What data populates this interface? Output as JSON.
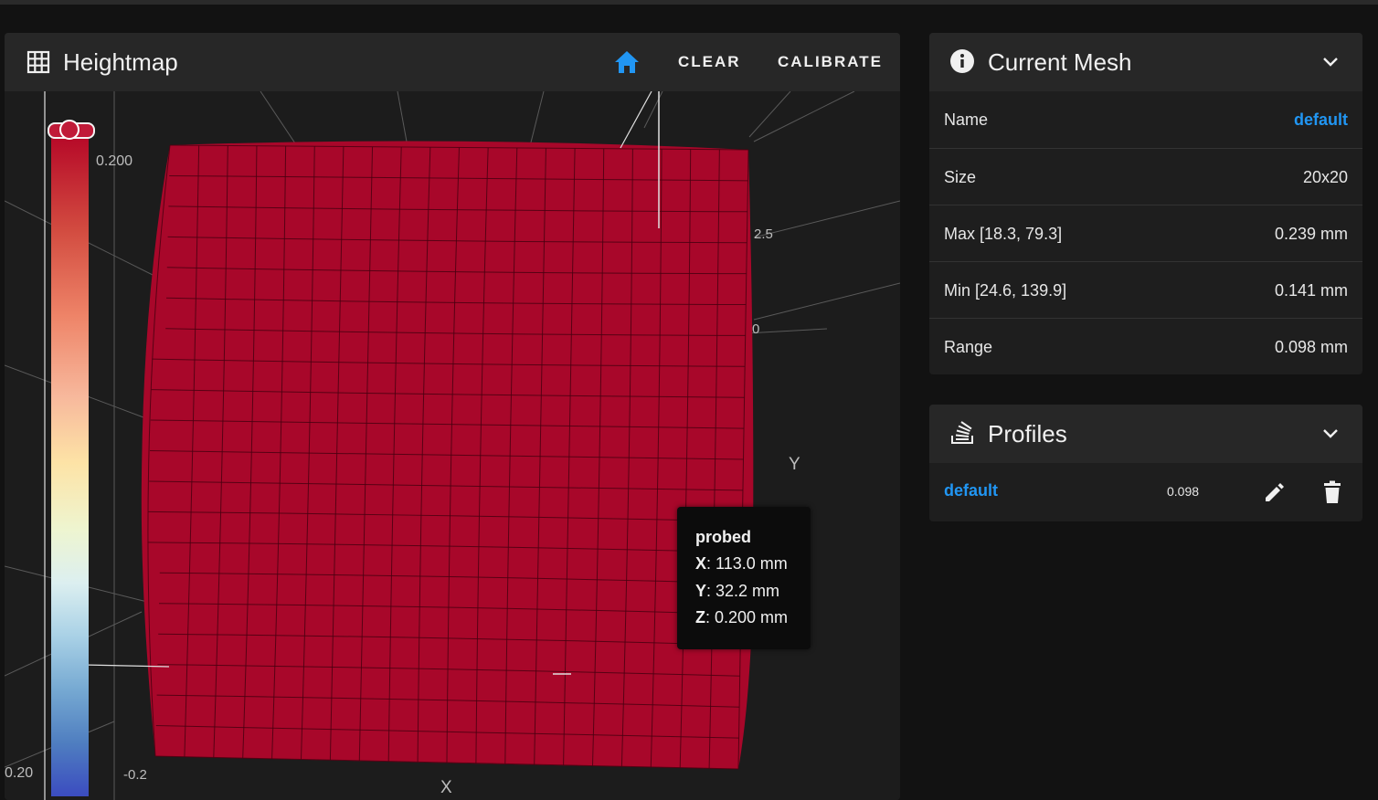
{
  "heightmap": {
    "title": "Heightmap",
    "clear_label": "CLEAR",
    "calibrate_label": "CALIBRATE",
    "colorbar": {
      "top_value": "0.200",
      "bottom_value": "0.20"
    },
    "axis": {
      "z_ticks": [
        "2.5",
        "0",
        "-0.2"
      ],
      "y_label": "Y",
      "x_label": "X"
    },
    "tooltip": {
      "title": "probed",
      "x_key": "X",
      "x_val": ": 113.0 mm",
      "y_key": "Y",
      "y_val": ": 32.2 mm",
      "z_key": "Z",
      "z_val": ": 0.200 mm"
    },
    "surface_color": "#a8072a",
    "grid_size": 20
  },
  "current_mesh": {
    "title": "Current Mesh",
    "rows": [
      {
        "key": "Name",
        "value": "default"
      },
      {
        "key": "Size",
        "value": "20x20"
      },
      {
        "key": "Max [18.3, 79.3]",
        "value": "0.239 mm"
      },
      {
        "key": "Min [24.6, 139.9]",
        "value": "0.141 mm"
      },
      {
        "key": "Range",
        "value": "0.098 mm"
      }
    ]
  },
  "profiles": {
    "title": "Profiles",
    "items": [
      {
        "name": "default",
        "range": "0.098"
      }
    ]
  },
  "colors": {
    "accent": "#2196f3",
    "card": "#1e1e1e",
    "header": "#272727"
  }
}
